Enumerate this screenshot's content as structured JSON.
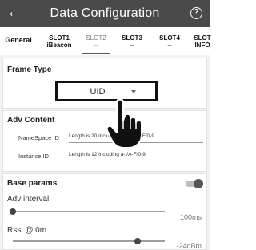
{
  "header": {
    "back_icon": "arrow-left-icon",
    "title": "Data Configuration",
    "help_icon": "help-circle-icon",
    "help_glyph": "?"
  },
  "tabs": [
    {
      "line1": "General",
      "line2": "",
      "active": false
    },
    {
      "line1": "SLOT1",
      "line2": "iBeacon",
      "active": false
    },
    {
      "line1": "SLOT2",
      "line2": "--",
      "active": true
    },
    {
      "line1": "SLOT3",
      "line2": "--",
      "active": false
    },
    {
      "line1": "SLOT4",
      "line2": "--",
      "active": false
    },
    {
      "line1": "SLOT",
      "line2": "INFO",
      "active": false
    }
  ],
  "frame_type": {
    "title": "Frame Type",
    "selected": "UID",
    "caret_icon": "caret-down-icon"
  },
  "adv_content": {
    "title": "Adv Content",
    "fields": [
      {
        "label": "NameSpace ID",
        "value": "Length is 20 including 0-9 a-f/A-F/0-9"
      },
      {
        "label": "Instance ID",
        "value": "Length is 12 including a-f/A-F/0-9"
      }
    ]
  },
  "base_params": {
    "title": "Base params",
    "toggle_on": true,
    "adv_interval": {
      "label": "Adv interval",
      "value": "100ms",
      "position": 0.0
    },
    "rssi": {
      "label": "Rssi @ 0m",
      "value": "-24dBm",
      "position": 0.82
    }
  },
  "overlay": {
    "pointer_icon": "pointing-hand-icon"
  }
}
